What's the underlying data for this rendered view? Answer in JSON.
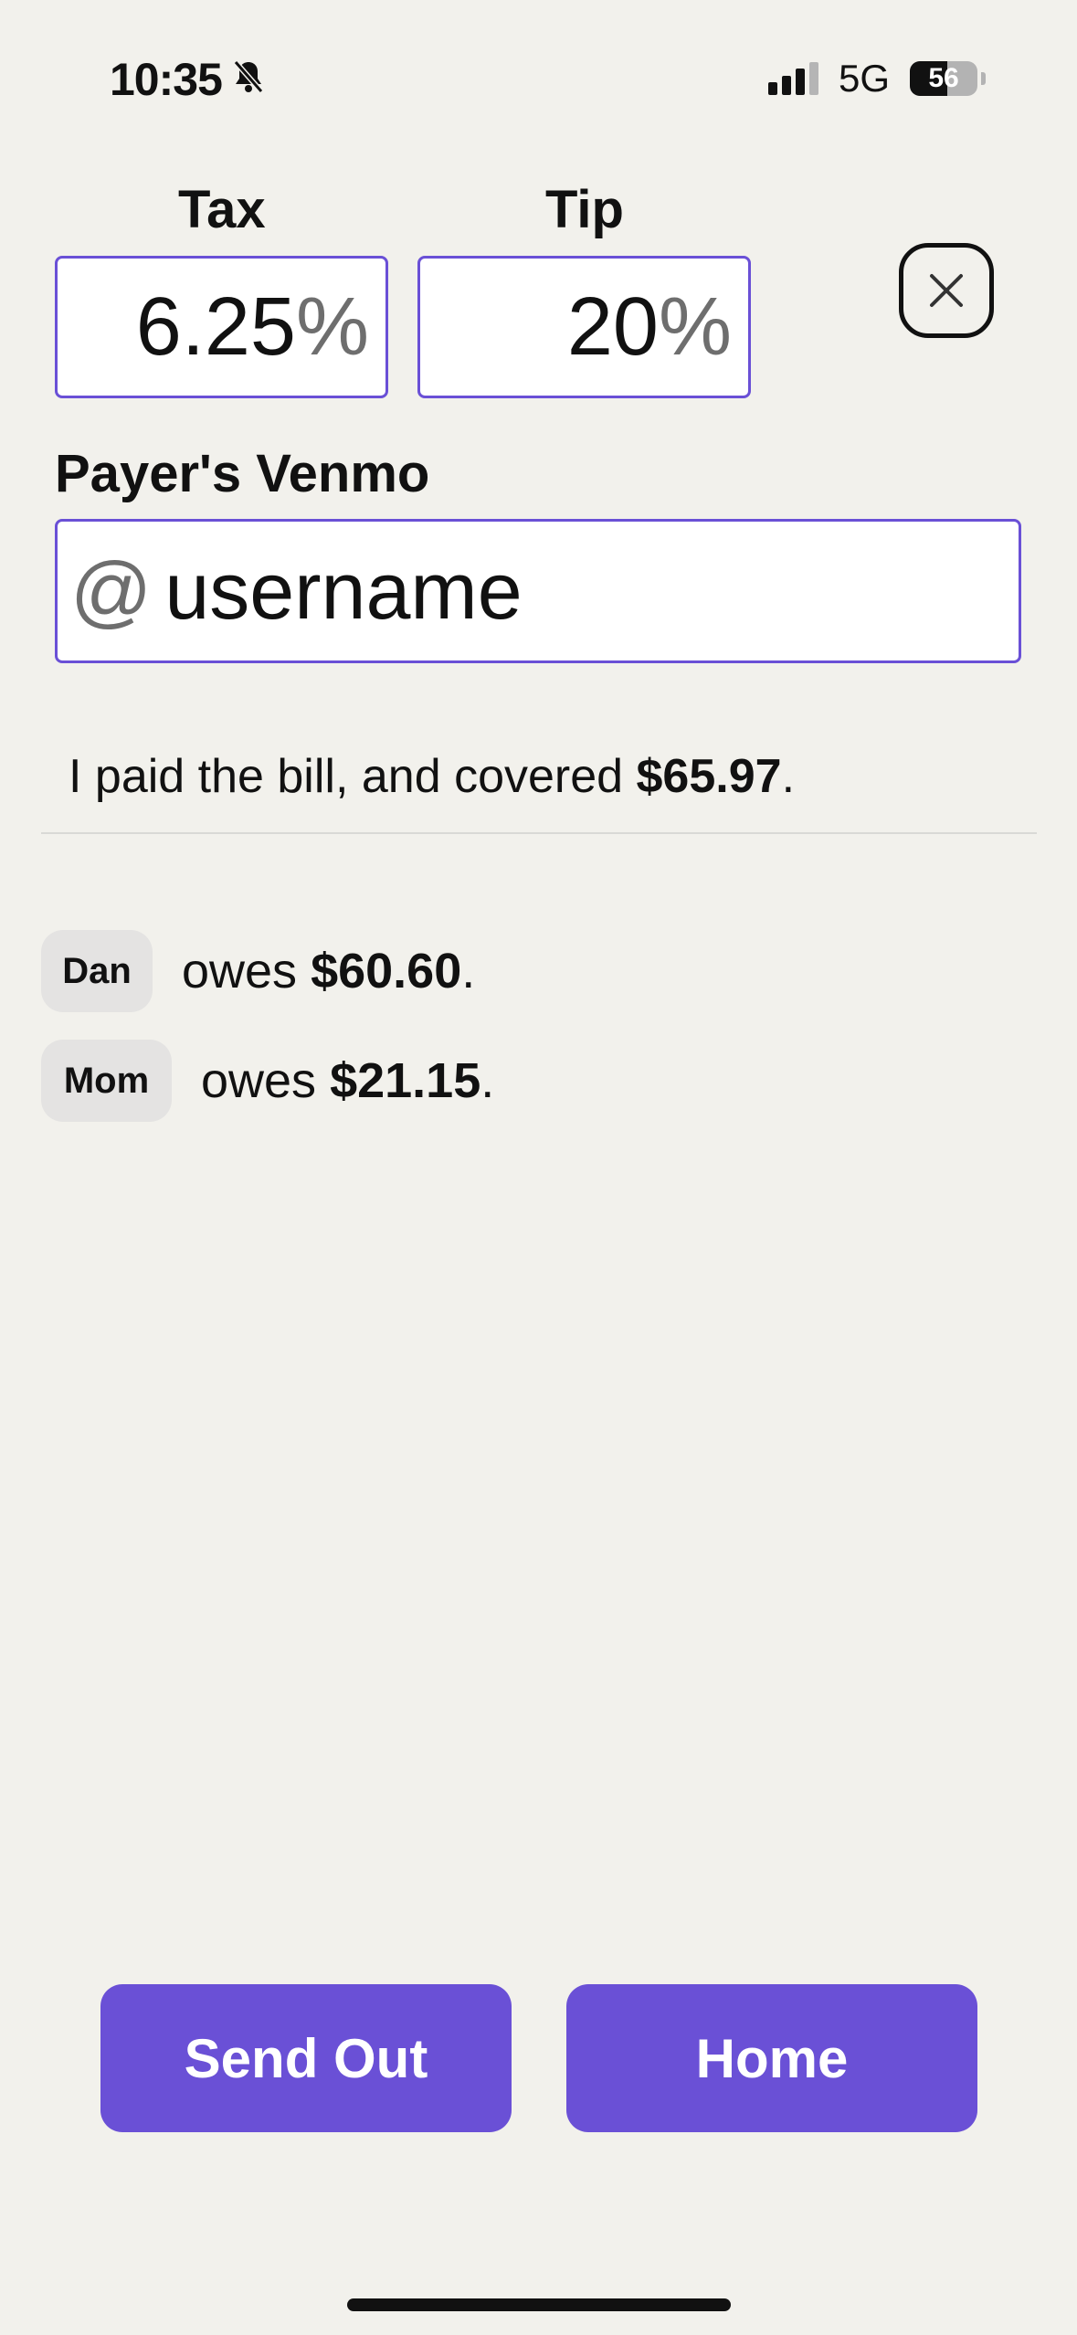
{
  "status_bar": {
    "time": "10:35",
    "network": "5G",
    "battery": "56",
    "battery_level": 0.56
  },
  "form": {
    "tax_label": "Tax",
    "tax_value": "6.25",
    "tip_label": "Tip",
    "tip_value": "20",
    "percent_symbol": "%",
    "venmo_label": "Payer's Venmo",
    "venmo_at": "@",
    "venmo_placeholder": "username"
  },
  "summary": {
    "prefix": "I paid the bill, and covered ",
    "amount": "$65.97",
    "suffix": "."
  },
  "debts": [
    {
      "name": "Dan",
      "verb": "owes ",
      "amount": "$60.60",
      "suffix": "."
    },
    {
      "name": "Mom",
      "verb": "owes ",
      "amount": "$21.15",
      "suffix": "."
    }
  ],
  "actions": {
    "send_out": "Send Out",
    "home": "Home"
  },
  "colors": {
    "accent": "#6a50d6",
    "background": "#f2f1ec",
    "chip": "#e4e3e2"
  }
}
